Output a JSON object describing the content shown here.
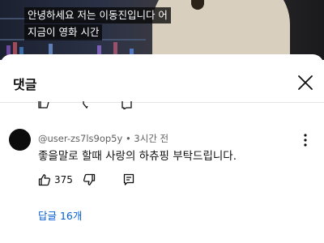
{
  "video": {
    "subtitle_line1": "안녕하세요 저는 이동진입니다 어",
    "subtitle_line2": "지금이 영화 시간"
  },
  "comments_panel": {
    "title": "댓글",
    "close_icon": "close-icon"
  },
  "comment": {
    "author": "@user-zs7ls9op5y",
    "separator": " • ",
    "time": "3시간 전",
    "text": "좋을말로 할때 사랑의 하츄핑 부탁드립니다.",
    "like_count": "375",
    "replies_label": "답글 16개",
    "icons": {
      "like": "thumbs-up-icon",
      "dislike": "thumbs-down-icon",
      "reply": "reply-icon",
      "menu": "more-vert-icon"
    }
  },
  "colors": {
    "link": "#065fd4",
    "meta_text": "#606060",
    "avatar": "#0c0c0c"
  }
}
